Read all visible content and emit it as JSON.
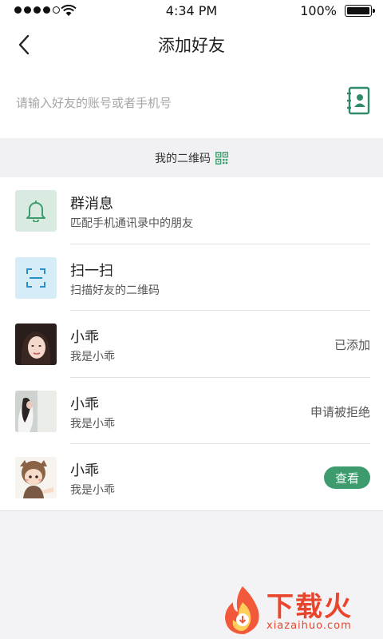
{
  "status_bar": {
    "time": "4:34 PM",
    "battery": "100%"
  },
  "header": {
    "title": "添加好友"
  },
  "search": {
    "placeholder": "请输入好友的账号或者手机号"
  },
  "qr_bar": {
    "label": "我的二维码"
  },
  "colors": {
    "accent": "#3d9b6e",
    "bell_bg": "#d9ebe0",
    "scan_bg": "#d6ecf7",
    "watermark": "#e8452c"
  },
  "list": [
    {
      "title": "群消息",
      "subtitle": "匹配手机通讯录中的朋友",
      "icon": "bell-icon"
    },
    {
      "title": "扫一扫",
      "subtitle": "扫描好友的二维码",
      "icon": "scan-icon"
    },
    {
      "title": "小乖",
      "subtitle": "我是小乖",
      "status": "已添加"
    },
    {
      "title": "小乖",
      "subtitle": "我是小乖",
      "status": "申请被拒绝"
    },
    {
      "title": "小乖",
      "subtitle": "我是小乖",
      "action": "查看"
    }
  ],
  "watermark": {
    "brand": "下载火",
    "url": "xiazaihuo.com"
  }
}
